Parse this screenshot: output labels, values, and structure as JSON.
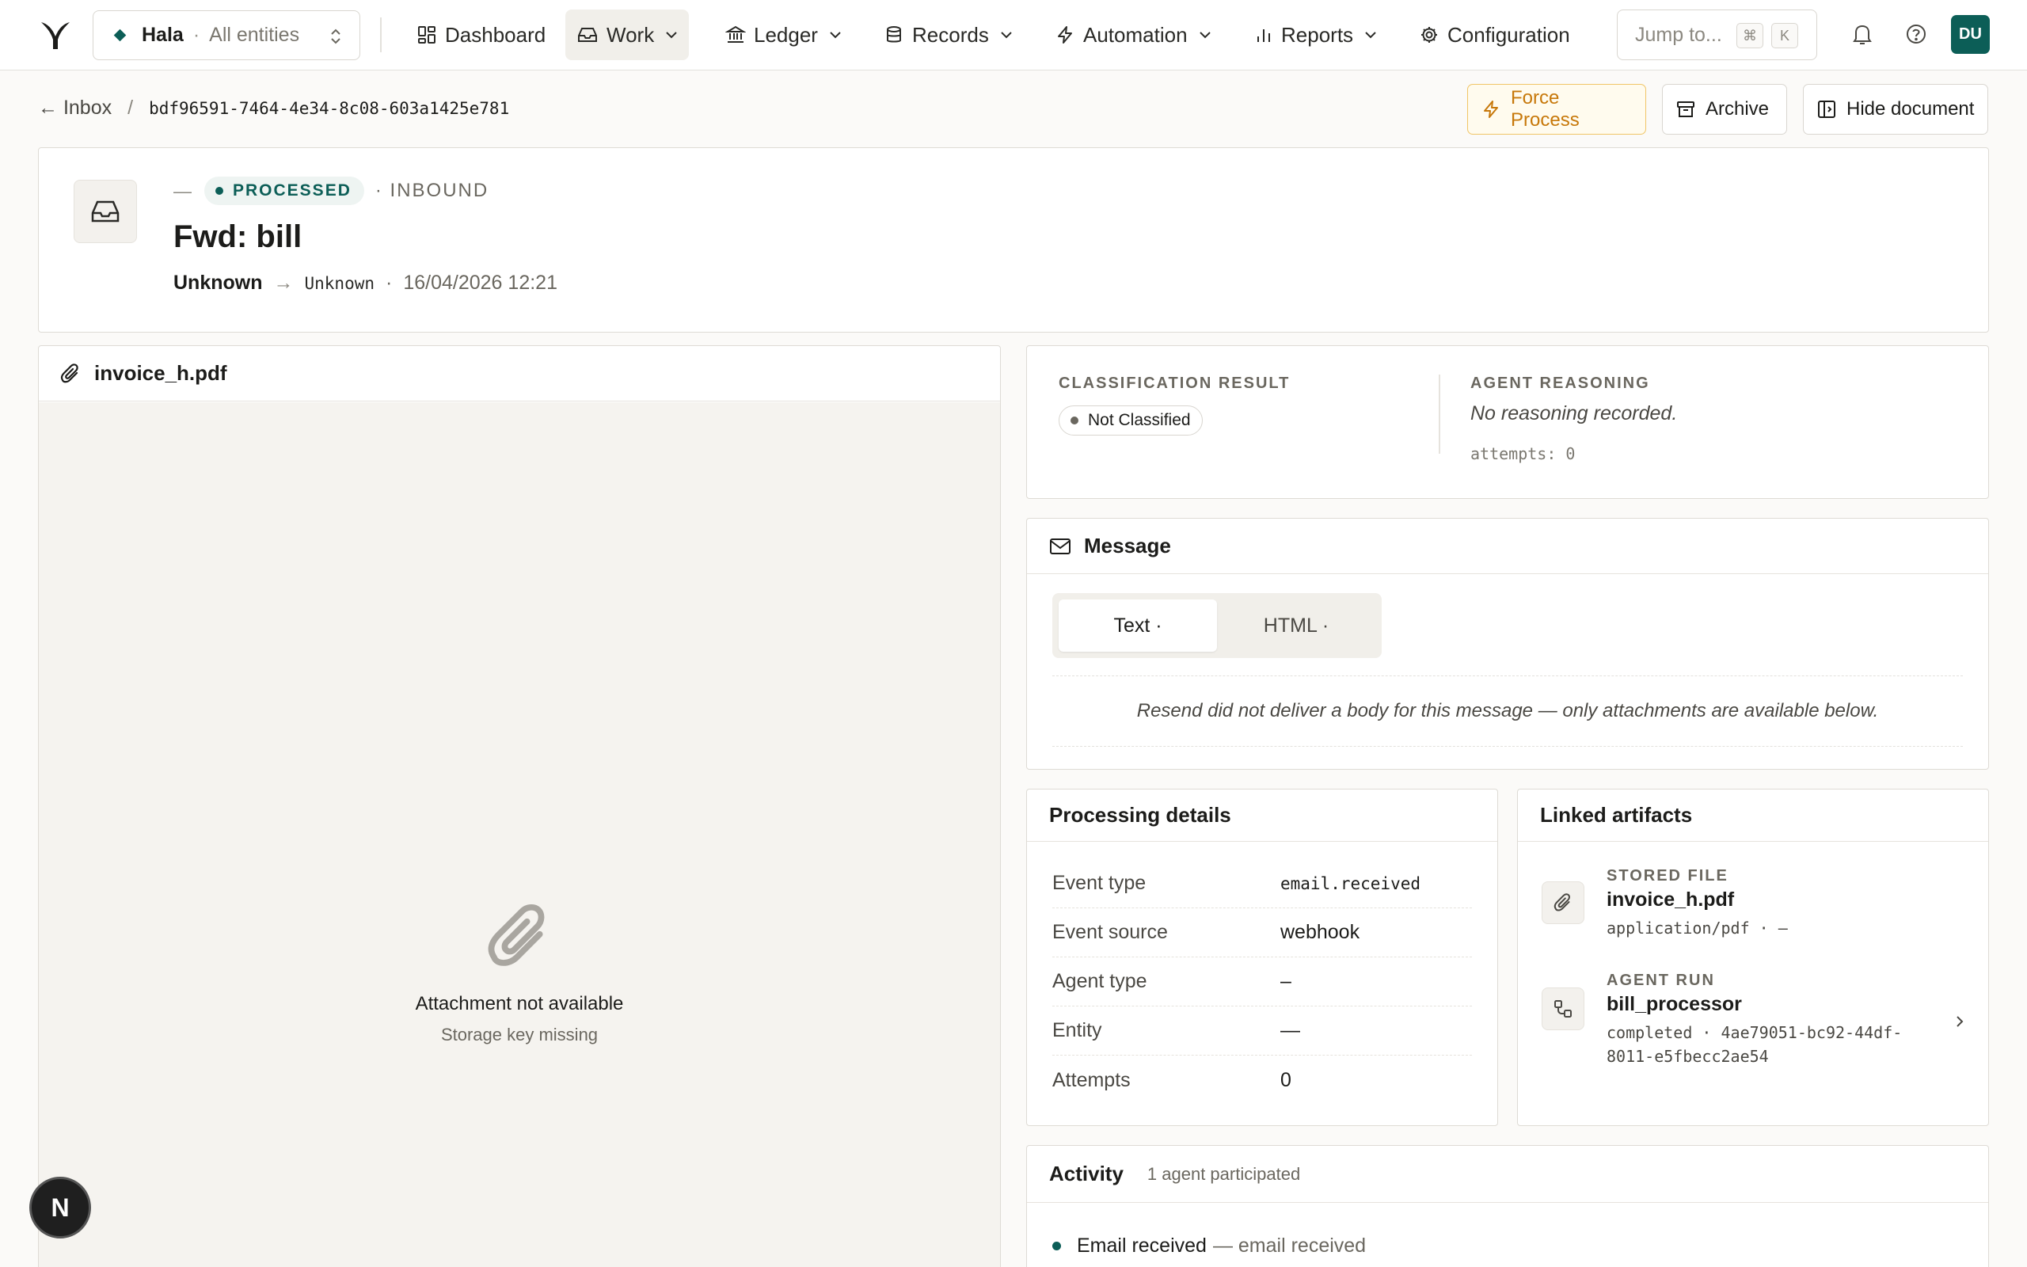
{
  "nav": {
    "entity_name": "Hala",
    "entity_scope": "All entities",
    "items": [
      {
        "label": "Dashboard"
      },
      {
        "label": "Work"
      },
      {
        "label": "Ledger"
      },
      {
        "label": "Records"
      },
      {
        "label": "Automation"
      },
      {
        "label": "Reports"
      },
      {
        "label": "Configuration"
      }
    ],
    "jump_placeholder": "Jump to...",
    "kbd_mod": "⌘",
    "kbd_key": "K",
    "avatar_initials": "DU"
  },
  "breadcrumb": {
    "back_label": "← Inbox",
    "separator": "/",
    "id": "bdf96591-7464-4e34-8c08-603a1425e781"
  },
  "actions": {
    "force_process": "Force Process",
    "archive": "Archive",
    "hide_document": "Hide document"
  },
  "header": {
    "dash": "—",
    "status": "PROCESSED",
    "direction": "· INBOUND",
    "subject": "Fwd: bill",
    "from": "Unknown",
    "arrow": "→",
    "to": "Unknown",
    "dot": "·",
    "timestamp": "16/04/2026 12:21"
  },
  "attachment": {
    "filename": "invoice_h.pdf",
    "empty_title": "Attachment not available",
    "empty_sub": "Storage key missing"
  },
  "classification": {
    "label": "CLASSIFICATION RESULT",
    "value": "Not Classified",
    "reasoning_label": "AGENT REASONING",
    "reasoning": "No reasoning recorded.",
    "attempts": "attempts: 0"
  },
  "message": {
    "title": "Message",
    "tabs": [
      {
        "label": "Text ·"
      },
      {
        "label": "HTML ·"
      }
    ],
    "body": "Resend did not deliver a body for this message — only attachments are available below."
  },
  "processing": {
    "title": "Processing details",
    "rows": [
      {
        "k": "Event type",
        "v": "email.received"
      },
      {
        "k": "Event source",
        "v": "webhook"
      },
      {
        "k": "Agent type",
        "v": "–"
      },
      {
        "k": "Entity",
        "v": "—"
      },
      {
        "k": "Attempts",
        "v": "0"
      }
    ]
  },
  "artifacts": {
    "title": "Linked artifacts",
    "items": [
      {
        "cap": "STORED FILE",
        "name": "invoice_h.pdf",
        "sub": "application/pdf · —"
      },
      {
        "cap": "AGENT RUN",
        "name": "bill_processor",
        "sub": "completed · 4ae79051-bc92-44df-8011-e5fbecc2ae54"
      }
    ]
  },
  "activity": {
    "title": "Activity",
    "summary": "1 agent participated",
    "item_title": "Email received",
    "item_meta": "— email received"
  },
  "dev_badge": "N",
  "colors": {
    "brand": "#0c5e57",
    "warning": "#c7780a",
    "background": "#fbfaf8"
  }
}
